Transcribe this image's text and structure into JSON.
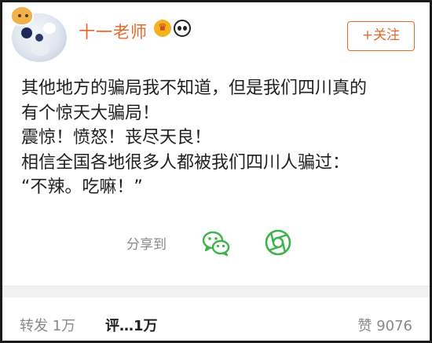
{
  "user": {
    "name": "十一老师",
    "follow_label": "+关注"
  },
  "badges": {
    "crown_glyph": "♛",
    "crown_icon": "crown-icon",
    "panda_icon": "panda-icon"
  },
  "post": {
    "lines": [
      "其他地方的骗局我不知道，但是我们四川真的",
      "有个惊天大骗局！",
      "震惊！愤怒！丧尽天良！",
      "相信全国各地很多人都被我们四川人骗过：",
      "“不辣。吃嘛！”"
    ]
  },
  "share": {
    "label": "分享到",
    "targets": [
      {
        "icon": "wechat-icon"
      },
      {
        "icon": "moments-icon"
      }
    ]
  },
  "actions": {
    "repost": "转发 1万",
    "comment": "评…1万",
    "like": "赞 9076"
  },
  "colors": {
    "accent": "#e8672b",
    "share_green": "#3bb34a",
    "muted": "#888888"
  }
}
